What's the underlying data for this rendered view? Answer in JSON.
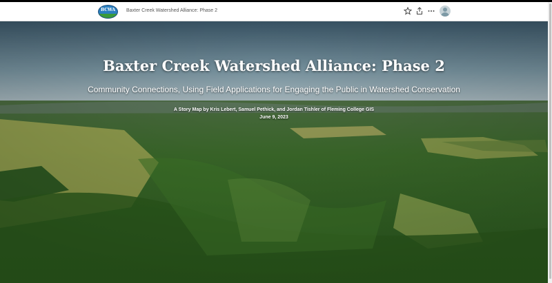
{
  "header": {
    "logo_text": "BCWA",
    "title": "Baxter Creek Watershed Alliance: Phase 2",
    "icons": [
      "star-icon",
      "share-icon",
      "more-options-icon",
      "user-avatar-icon"
    ]
  },
  "hero": {
    "title": "Baxter Creek Watershed Alliance: Phase 2",
    "subtitle": "Community Connections, Using Field Applications for Engaging the Public in Watershed Conservation",
    "byline": "A Story Map by Kris Lebert, Samuel Pethick, and Jordan Tishler of Fleming College GIS",
    "date": "June 9, 2023"
  },
  "colors": {
    "sky_top": "#3e5868",
    "sky_horizon": "#a9b8c0",
    "forest_dark": "#1f4a1c",
    "forest_light": "#5a8e32",
    "field": "#a6aa55",
    "text": "#ffffff"
  }
}
